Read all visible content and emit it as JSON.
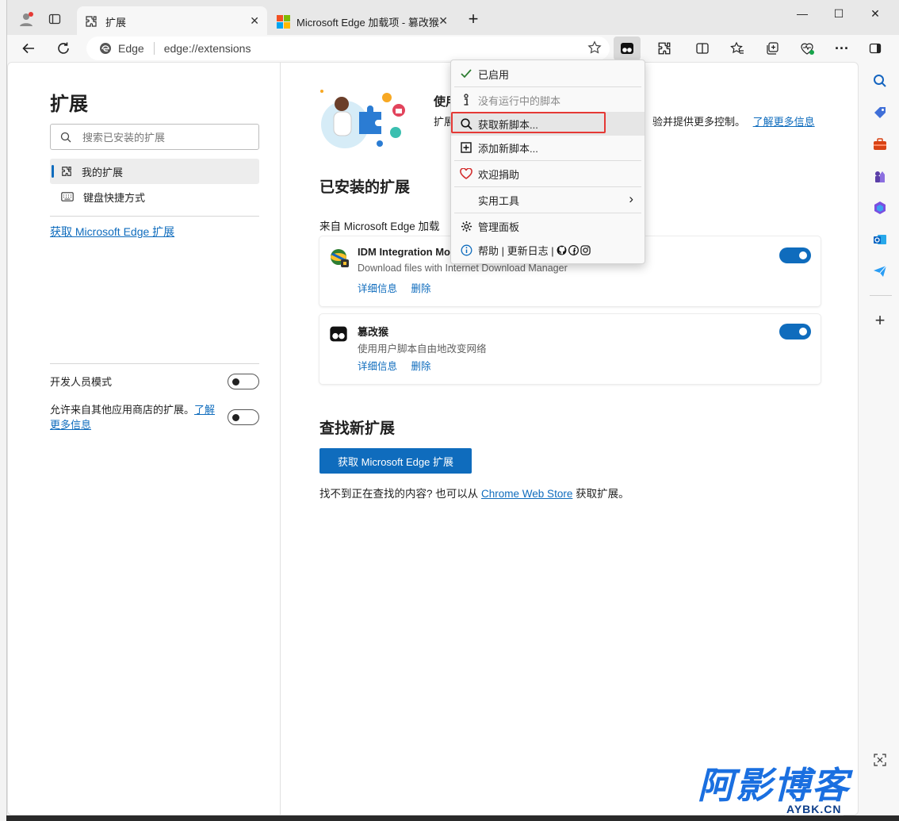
{
  "window": {
    "tabs": [
      {
        "label": "扩展",
        "icon": "puzzle-icon"
      },
      {
        "label": "Microsoft Edge 加载项 - 篡改猴",
        "icon": "microsoft-logo-icon"
      }
    ],
    "controls": {
      "minimize": "—",
      "maximize": "☐",
      "close": "✕"
    }
  },
  "toolbar": {
    "edge_label": "Edge",
    "url": "edge://extensions"
  },
  "left": {
    "title": "扩展",
    "search_placeholder": "搜索已安装的扩展",
    "nav": [
      {
        "label": "我的扩展",
        "selected": true
      },
      {
        "label": "键盘快捷方式",
        "selected": false
      }
    ],
    "get_link": "获取 Microsoft Edge 扩展",
    "dev_mode": "开发人员模式",
    "allow_other": "允许来自其他应用商店的扩展。",
    "allow_other_link": "了解更多信息"
  },
  "main": {
    "promo_title": "使用",
    "promo_text_left": "扩展",
    "promo_text_right": "验并提供更多控制。",
    "promo_link": "了解更多信息",
    "installed_heading": "已安装的扩展",
    "from_store": "来自 Microsoft Edge 加载",
    "extensions": [
      {
        "name": "IDM Integration Mo",
        "desc": "Download files with Internet Download Manager",
        "details": "详细信息",
        "remove": "删除",
        "enabled": true
      },
      {
        "name": "篡改猴",
        "desc": "使用用户脚本自由地改变网络",
        "details": "详细信息",
        "remove": "删除",
        "enabled": true
      }
    ],
    "find_heading": "查找新扩展",
    "get_button": "获取 Microsoft Edge 扩展",
    "footer_prefix": "找不到正在查找的内容? 也可以从",
    "footer_link": "Chrome Web Store",
    "footer_suffix": "获取扩展。"
  },
  "menu": {
    "items": [
      {
        "label": "已启用",
        "icon": "check-icon"
      },
      {
        "label": "没有运行中的脚本",
        "icon": "info-i-icon",
        "disabled": true
      },
      {
        "label": "获取新脚本...",
        "icon": "search-icon",
        "highlight": true
      },
      {
        "label": "添加新脚本...",
        "icon": "plus-square-icon"
      },
      {
        "label": "欢迎捐助",
        "icon": "heart-icon"
      },
      {
        "label": "实用工具",
        "icon": "",
        "submenu": "›"
      },
      {
        "label": "管理面板",
        "icon": "gear-icon"
      },
      {
        "label": "帮助 | 更新日志 |",
        "icon": "info-circle-icon"
      }
    ]
  },
  "watermark": {
    "main": "阿影博客",
    "sub": "AYBK.CN"
  },
  "colors": {
    "accent": "#0f6cbd",
    "highlight_box": "#e53935"
  }
}
